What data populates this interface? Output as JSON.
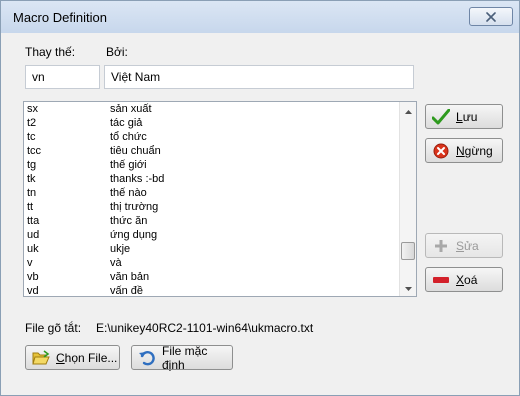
{
  "window": {
    "title": "Macro Definition"
  },
  "form": {
    "replace_label": "Thay thế:",
    "with_label": "Bởi:",
    "replace_value": "vn",
    "with_value": "Việt Nam"
  },
  "macros": [
    {
      "k": "sx",
      "v": "sản xuất"
    },
    {
      "k": "t2",
      "v": "tác giả"
    },
    {
      "k": "tc",
      "v": "tổ chức"
    },
    {
      "k": "tcc",
      "v": "tiêu chuẩn"
    },
    {
      "k": "tg",
      "v": "thế giới"
    },
    {
      "k": "tk",
      "v": "thanks :-bd"
    },
    {
      "k": "tn",
      "v": "thế nào"
    },
    {
      "k": "tt",
      "v": "thị trường"
    },
    {
      "k": "tta",
      "v": "thức ăn"
    },
    {
      "k": "ud",
      "v": "ứng dụng"
    },
    {
      "k": "uk",
      "v": "ukje"
    },
    {
      "k": "v",
      "v": "và"
    },
    {
      "k": "vb",
      "v": "văn bản"
    },
    {
      "k": "vd",
      "v": "vấn đề"
    }
  ],
  "buttons": {
    "save": {
      "first": "L",
      "rest": "ưu"
    },
    "stop": {
      "first": "N",
      "rest": "gừng"
    },
    "edit": {
      "first": "S",
      "rest": "ửa"
    },
    "delete": {
      "first": "X",
      "rest": "oá"
    },
    "choose_file": {
      "first": "C",
      "rest": "họn File..."
    },
    "default_file": "File mặc định"
  },
  "file": {
    "label": "File gõ tắt:",
    "path": "E:\\unikey40RC2-1101-win64\\ukmacro.txt"
  },
  "colors": {
    "check_green": "#2e9a1e",
    "stop_red": "#d9341c",
    "delete_red": "#d3202a"
  }
}
